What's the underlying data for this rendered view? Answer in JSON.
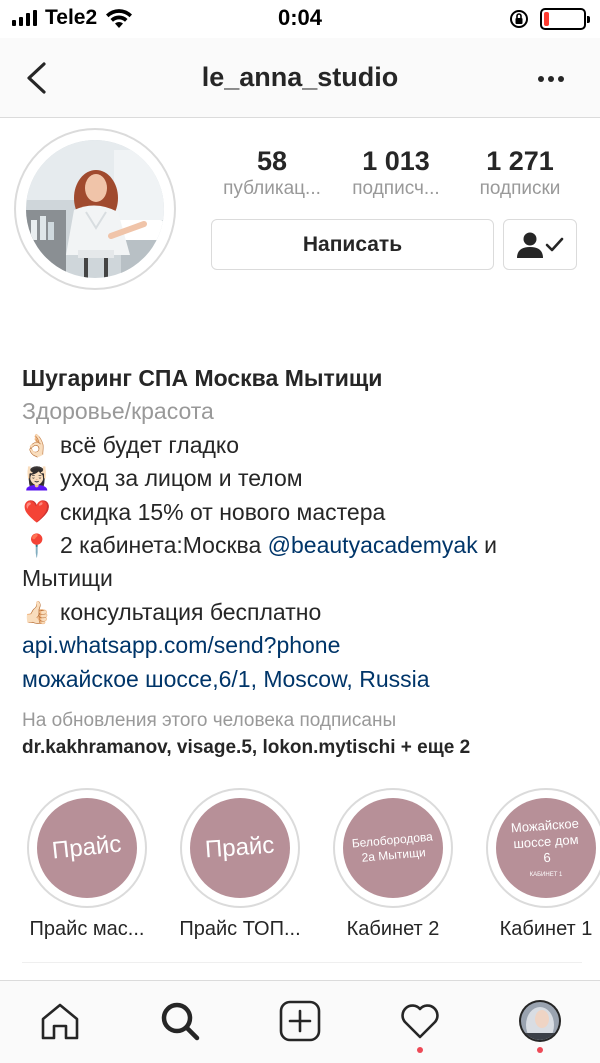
{
  "status_bar": {
    "carrier": "Tele2",
    "time": "0:04",
    "battery_level": 0.12,
    "battery_color": "#ff3b30"
  },
  "header": {
    "username": "le_anna_studio",
    "back_icon": "chevron-left-icon",
    "more_icon": "ellipsis-icon"
  },
  "profile": {
    "stats": [
      {
        "value": "58",
        "label": "публикац..."
      },
      {
        "value": "1 013",
        "label": "подписч..."
      },
      {
        "value": "1 271",
        "label": "подписки"
      }
    ],
    "message_button": "Написать",
    "follow_icon": "person-check-icon"
  },
  "bio": {
    "name": "Шугаринг СПА Москва Мытищи",
    "category": "Здоровье/красота",
    "lines": [
      {
        "emoji": "👌🏻",
        "text": "всё будет гладко"
      },
      {
        "emoji": "💆🏻‍♀️",
        "text": "уход за лицом и телом"
      },
      {
        "emoji": "❤️",
        "text": "скидка 15% от нового мастера"
      }
    ],
    "location_line": {
      "emoji": "📍",
      "text_before": "2 кабинета:Москва ",
      "mention": "@beautyacademyak",
      "text_after": " и Мытищи"
    },
    "consult_line": {
      "emoji": "👍🏻",
      "text": "консультация бесплатно"
    },
    "website": "api.whatsapp.com/send?phone",
    "address": "можайское шоссе,6/1, Moscow, Russia"
  },
  "followed_by": {
    "caption": "На обновления этого человека подписаны",
    "names": [
      "dr.kakhramanov",
      "visage.5",
      "lokon.mytischi"
    ],
    "more": "+ еще 2"
  },
  "highlights": [
    {
      "cover_text": "Прайс",
      "label": "Прайс мас..."
    },
    {
      "cover_text": "Прайс",
      "label": "Прайс ТОП..."
    },
    {
      "cover_text": "Белобородова 2а Мытищи",
      "label": "Кабинет 2"
    },
    {
      "cover_text": "Можайское шоссе дом 6",
      "cover_subtext": "кабинет 1",
      "label": "Кабинет 1"
    }
  ],
  "tabbar": {
    "icons": [
      "home-icon",
      "search-icon",
      "add-post-icon",
      "heart-icon",
      "profile-avatar"
    ],
    "accent": "#ed4956"
  }
}
